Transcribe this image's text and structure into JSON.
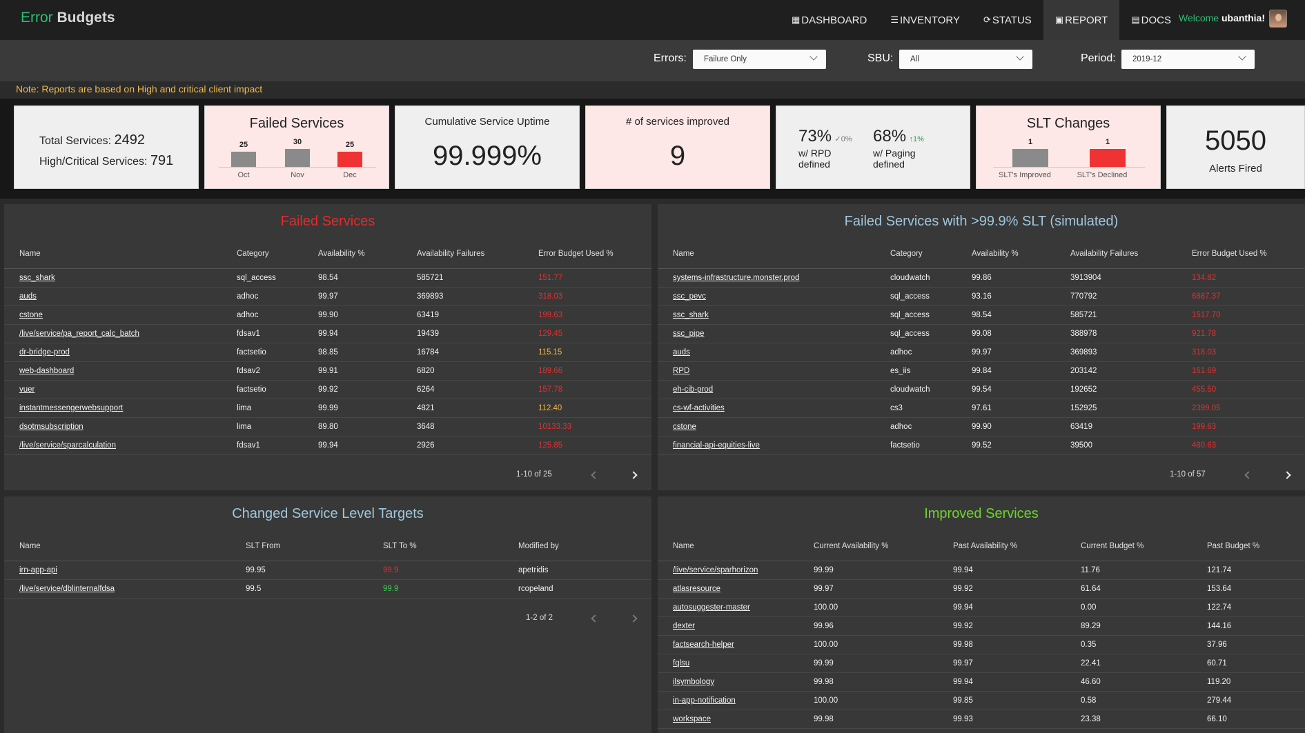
{
  "brand": {
    "part1": "Error",
    "part2": "Budgets"
  },
  "nav": {
    "items": [
      {
        "label": "DASHBOARD",
        "icon": "▦"
      },
      {
        "label": "INVENTORY",
        "icon": "☰"
      },
      {
        "label": "STATUS",
        "icon": "⟳"
      },
      {
        "label": "REPORT",
        "icon": "▣"
      },
      {
        "label": "DOCS",
        "icon": "▤"
      }
    ],
    "active": "REPORT",
    "welcome_prefix": "Welcome",
    "user": "ubanthia!"
  },
  "filters": {
    "errors": {
      "label": "Errors:",
      "value": "Failure Only"
    },
    "sbu": {
      "label": "SBU:",
      "value": "All"
    },
    "period": {
      "label": "Period:",
      "value": "2019-12"
    }
  },
  "note": "Note: Reports are based on High and critical client impact",
  "kpi": {
    "totals": {
      "total_label": "Total Services:",
      "total_value": "2492",
      "high_label": "High/Critical Services:",
      "high_value": "791"
    },
    "failed": {
      "title": "Failed Services",
      "bars": [
        {
          "month": "Oct",
          "value": 25,
          "color": "gray"
        },
        {
          "month": "Nov",
          "value": 30,
          "color": "gray"
        },
        {
          "month": "Dec",
          "value": 25,
          "color": "red"
        }
      ]
    },
    "uptime": {
      "title": "Cumulative Service Uptime",
      "value": "99.999%"
    },
    "improved": {
      "title": "# of services improved",
      "value": "9"
    },
    "coverage": {
      "rpd_value": "73%",
      "rpd_delta": "✓0%",
      "rpd_label1": "w/ RPD",
      "rpd_label2": "defined",
      "paging_value": "68%",
      "paging_delta": "↑1%",
      "paging_label1": "w/ Paging",
      "paging_label2": "defined"
    },
    "slt": {
      "title": "SLT Changes",
      "bars": [
        {
          "label": "SLT's Improved",
          "value": 1,
          "color": "gray"
        },
        {
          "label": "SLT's Declined",
          "value": 1,
          "color": "red"
        }
      ]
    },
    "alerts": {
      "value": "5050",
      "label": "Alerts Fired"
    }
  },
  "failed_services": {
    "title": "Failed Services",
    "headers": [
      "Name",
      "Category",
      "Availability %",
      "Availability Failures",
      "Error Budget Used %"
    ],
    "rows": [
      [
        "ssc_shark",
        "sql_access",
        "98.54",
        "585721",
        "151.77",
        "red"
      ],
      [
        "auds",
        "adhoc",
        "99.97",
        "369893",
        "318.03",
        "red"
      ],
      [
        "cstone",
        "adhoc",
        "99.90",
        "63419",
        "199.63",
        "red"
      ],
      [
        "/live/service/pa_report_calc_batch",
        "fdsav1",
        "99.94",
        "19439",
        "129.45",
        "red"
      ],
      [
        "dr-bridge-prod",
        "factsetio",
        "98.85",
        "16784",
        "115.15",
        "orange"
      ],
      [
        "web-dashboard",
        "fdsav2",
        "99.91",
        "6820",
        "189.66",
        "red"
      ],
      [
        "vuer",
        "factsetio",
        "99.92",
        "6264",
        "157.78",
        "red"
      ],
      [
        "instantmessengerwebsupport",
        "lima",
        "99.99",
        "4821",
        "112.40",
        "orange"
      ],
      [
        "dsotmsubscription",
        "lima",
        "89.80",
        "3648",
        "10133.33",
        "red"
      ],
      [
        "/live/service/sparcalculation",
        "fdsav1",
        "99.94",
        "2926",
        "125.85",
        "red"
      ]
    ],
    "pagination": "1-10 of 25"
  },
  "failed_simulated": {
    "title": "Failed Services with >99.9% SLT (simulated)",
    "headers": [
      "Name",
      "Category",
      "Availability %",
      "Availability Failures",
      "Error Budget Used %"
    ],
    "rows": [
      [
        "systems-infrastructure.monster.prod",
        "cloudwatch",
        "99.86",
        "3913904",
        "134.82",
        "red"
      ],
      [
        "ssc_pevc",
        "sql_access",
        "93.16",
        "770792",
        "6887.37",
        "red"
      ],
      [
        "ssc_shark",
        "sql_access",
        "98.54",
        "585721",
        "1517.70",
        "red"
      ],
      [
        "ssc_pipe",
        "sql_access",
        "99.08",
        "388978",
        "921.78",
        "red"
      ],
      [
        "auds",
        "adhoc",
        "99.97",
        "369893",
        "318.03",
        "red"
      ],
      [
        "RPD",
        "es_iis",
        "99.84",
        "203142",
        "161.69",
        "red"
      ],
      [
        "eh-cib-prod",
        "cloudwatch",
        "99.54",
        "192652",
        "455.50",
        "red"
      ],
      [
        "cs-wf-activities",
        "cs3",
        "97.61",
        "152925",
        "2399.05",
        "red"
      ],
      [
        "cstone",
        "adhoc",
        "99.90",
        "63419",
        "199.63",
        "red"
      ],
      [
        "financial-api-equities-live",
        "factsetio",
        "99.52",
        "39500",
        "480.63",
        "red"
      ]
    ],
    "pagination": "1-10 of 57"
  },
  "changed_slt": {
    "title": "Changed Service Level Targets",
    "headers": [
      "Name",
      "SLT From",
      "SLT To %",
      "Modified by"
    ],
    "rows": [
      [
        "irn-app-api",
        "99.95",
        "99.9",
        "apetridis",
        "red"
      ],
      [
        "/live/service/dblinternalfdsa",
        "99.5",
        "99.9",
        "rcopeland",
        "green"
      ]
    ],
    "pagination": "1-2 of 2"
  },
  "improved_services": {
    "title": "Improved Services",
    "headers": [
      "Name",
      "Current Availability %",
      "Past Availability %",
      "Current Budget %",
      "Past Budget %"
    ],
    "rows": [
      [
        "/live/service/sparhorizon",
        "99.99",
        "99.94",
        "11.76",
        "121.74"
      ],
      [
        "atlasresource",
        "99.97",
        "99.92",
        "61.64",
        "153.64"
      ],
      [
        "autosuggester-master",
        "100.00",
        "99.94",
        "0.00",
        "122.74"
      ],
      [
        "dexter",
        "99.96",
        "99.92",
        "89.29",
        "144.16"
      ],
      [
        "factsearch-helper",
        "100.00",
        "99.98",
        "0.35",
        "37.96"
      ],
      [
        "fqlsu",
        "99.99",
        "99.97",
        "22.41",
        "60.71"
      ],
      [
        "ilsymbology",
        "99.98",
        "99.94",
        "46.60",
        "119.20"
      ],
      [
        "in-app-notification",
        "100.00",
        "99.85",
        "0.58",
        "279.44"
      ],
      [
        "workspace",
        "99.98",
        "99.93",
        "23.38",
        "66.10"
      ]
    ]
  },
  "colors": {
    "accent_green": "#2fbe73",
    "alert_red": "#e03030",
    "warn_orange": "#f3b640",
    "title_blue": "#9fc7dd",
    "title_lime": "#6ed62a"
  }
}
